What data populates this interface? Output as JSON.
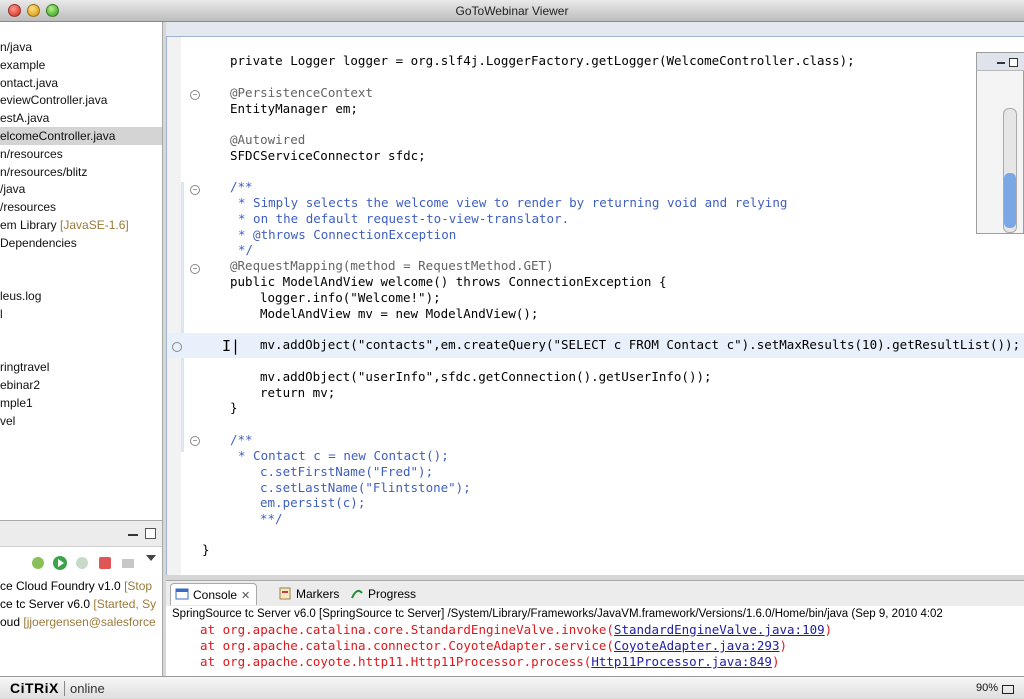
{
  "window": {
    "title": "GoToWebinar Viewer"
  },
  "explorer": {
    "items": [
      {
        "text": "n/java"
      },
      {
        "text": "example"
      },
      {
        "text": "ontact.java"
      },
      {
        "text": "eviewController.java"
      },
      {
        "text": "estA.java"
      },
      {
        "text": "elcomeController.java",
        "selected": true
      },
      {
        "text": "n/resources"
      },
      {
        "text": "n/resources/blitz"
      },
      {
        "text": "/java"
      },
      {
        "text": "/resources"
      },
      {
        "text": "em Library ",
        "dec": "[JavaSE-1.6]"
      },
      {
        "text": "Dependencies"
      },
      {
        "text": ""
      },
      {
        "text": ""
      },
      {
        "text": "leus.log"
      },
      {
        "text": "l"
      },
      {
        "text": ""
      },
      {
        "text": ""
      },
      {
        "text": "ringtravel"
      },
      {
        "text": "ebinar2"
      },
      {
        "text": "mple1"
      },
      {
        "text": "vel"
      }
    ]
  },
  "servers": {
    "rows": [
      {
        "name": "ce Cloud Foundry v1.0 ",
        "status": "[Stop"
      },
      {
        "name": "ce tc Server v6.0 ",
        "status": "[Started, Sy"
      },
      {
        "name": "oud ",
        "status": "[jjoergensen@salesforce"
      }
    ]
  },
  "editor": {
    "lines": [
      {
        "indent": "    ",
        "text": "private Logger logger = org.slf4j.LoggerFactory.getLogger(WelcomeController.class);"
      },
      {
        "indent": "    ",
        "text": "@PersistenceContext"
      },
      {
        "indent": "    ",
        "text": "EntityManager em;"
      },
      {
        "indent": "    ",
        "text": "@Autowired"
      },
      {
        "indent": "    ",
        "text": "SFDCServiceConnector sfdc;"
      },
      {
        "indent": "    ",
        "text": "/**"
      },
      {
        "indent": "     ",
        "text": "* Simply selects the welcome view to render by returning void and relying"
      },
      {
        "indent": "     ",
        "text": "* on the default request-to-view-translator."
      },
      {
        "indent": "     ",
        "text": "* @throws ConnectionException"
      },
      {
        "indent": "     ",
        "text": "*/"
      },
      {
        "indent": "    ",
        "text": "@RequestMapping(method = RequestMethod.GET)"
      },
      {
        "indent": "    ",
        "text": "public ModelAndView welcome() throws ConnectionException {"
      },
      {
        "indent": "        ",
        "text": "logger.info(\"Welcome!\");"
      },
      {
        "indent": "        ",
        "text": "ModelAndView mv = new ModelAndView();"
      },
      {
        "indent": "        ",
        "text": "mv.addObject(\"contacts\",em.createQuery(\"SELECT c FROM Contact c\").setMaxResults(10).getResultList());"
      },
      {
        "indent": "        ",
        "text": "mv.addObject(\"userInfo\",sfdc.getConnection().getUserInfo());"
      },
      {
        "indent": "        ",
        "text": "return mv;"
      },
      {
        "indent": "    ",
        "text": "}"
      },
      {
        "indent": "    ",
        "text": "/**"
      },
      {
        "indent": "     ",
        "text": "* Contact c = new Contact();"
      },
      {
        "indent": "        ",
        "text": "c.setFirstName(\"Fred\");"
      },
      {
        "indent": "        ",
        "text": "c.setLastName(\"Flintstone\");"
      },
      {
        "indent": "        ",
        "text": "em.persist(c);"
      },
      {
        "indent": "        ",
        "text": "**/"
      },
      {
        "indent": "",
        "text": "}"
      }
    ]
  },
  "console": {
    "tabs": [
      {
        "label": "Console",
        "close": "✕"
      },
      {
        "label": "Markers"
      },
      {
        "label": "Progress"
      }
    ],
    "header": "SpringSource tc Server v6.0 [SpringSource tc Server] /System/Library/Frameworks/JavaVM.framework/Versions/1.6.0/Home/bin/java (Sep 9, 2010 4:02",
    "lines": [
      {
        "prefix": "at org.apache.catalina.core.StandardEngineValve.invoke(",
        "link": "StandardEngineValve.java:109",
        "suffix": ")"
      },
      {
        "prefix": "at org.apache.catalina.connector.CoyoteAdapter.service(",
        "link": "CoyoteAdapter.java:293",
        "suffix": ")"
      },
      {
        "prefix": "at org.apache.coyote.http11.Http11Processor.process(",
        "link": "Http11Processor.java:849",
        "suffix": ")"
      }
    ]
  },
  "citrix": {
    "logo": "CiTRiX",
    "online": "online",
    "zoom": "90%"
  }
}
